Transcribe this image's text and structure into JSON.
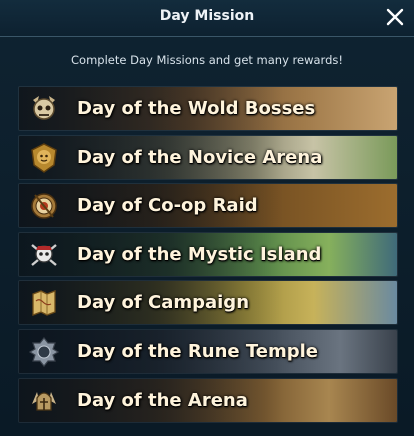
{
  "header": {
    "title": "Day Mission"
  },
  "subtitle": "Complete Day Missions and get many rewards!",
  "missions": [
    {
      "label": "Day of the Wold Bosses",
      "icon": "boss-skull-icon"
    },
    {
      "label": "Day of the Novice Arena",
      "icon": "lion-crest-icon"
    },
    {
      "label": "Day of Co-op Raid",
      "icon": "shield-target-icon"
    },
    {
      "label": "Day of the Mystic Island",
      "icon": "pirate-skull-icon"
    },
    {
      "label": "Day of Campaign",
      "icon": "map-scroll-icon"
    },
    {
      "label": "Day of the Rune Temple",
      "icon": "rune-gem-icon"
    },
    {
      "label": "Day of the Arena",
      "icon": "arena-helmet-icon"
    }
  ],
  "colors": {
    "background": "#0b1620",
    "label": "#fff4dc",
    "header_border": "#3a5668"
  }
}
